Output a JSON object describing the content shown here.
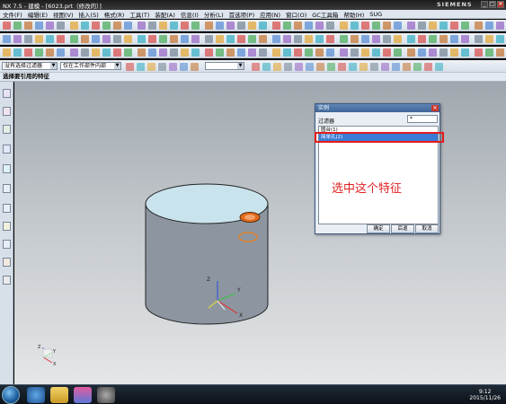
{
  "window": {
    "title": "NX 7.5 - 建模 - [6023.prt（修改的）]",
    "brand": "SIEMENS",
    "btn_min": "_",
    "btn_max": "□",
    "btn_close": "✕"
  },
  "menu": [
    "文件(F)",
    "编辑(E)",
    "视图(V)",
    "插入(S)",
    "格式(R)",
    "工具(T)",
    "装配(A)",
    "信息(I)",
    "分析(L)",
    "首选项(P)",
    "应用(N)",
    "窗口(O)",
    "GC工具箱",
    "帮助(H)",
    "SUG"
  ],
  "selection_bar": {
    "filter": "没有选择过滤器",
    "scope": "仅在工作部件内部"
  },
  "cue_line": "选择要引用的特征",
  "dialog": {
    "title": "实例",
    "close": "✕",
    "filter_label": "过滤器",
    "filter_value": "*",
    "list_items": [
      "圆台(1)",
      "简单孔(2)"
    ],
    "selected_index": 1,
    "annotation": "选中这个特征",
    "ok": "确定",
    "back": "后退",
    "cancel": "取消"
  },
  "triad_labels": {
    "z": "Z",
    "y": "Y",
    "x": "X"
  },
  "view_triad_labels": {
    "z": "Z",
    "y": "Y",
    "x": "X"
  },
  "taskbar": {
    "time": "9:12",
    "date": "2015/11/26"
  }
}
